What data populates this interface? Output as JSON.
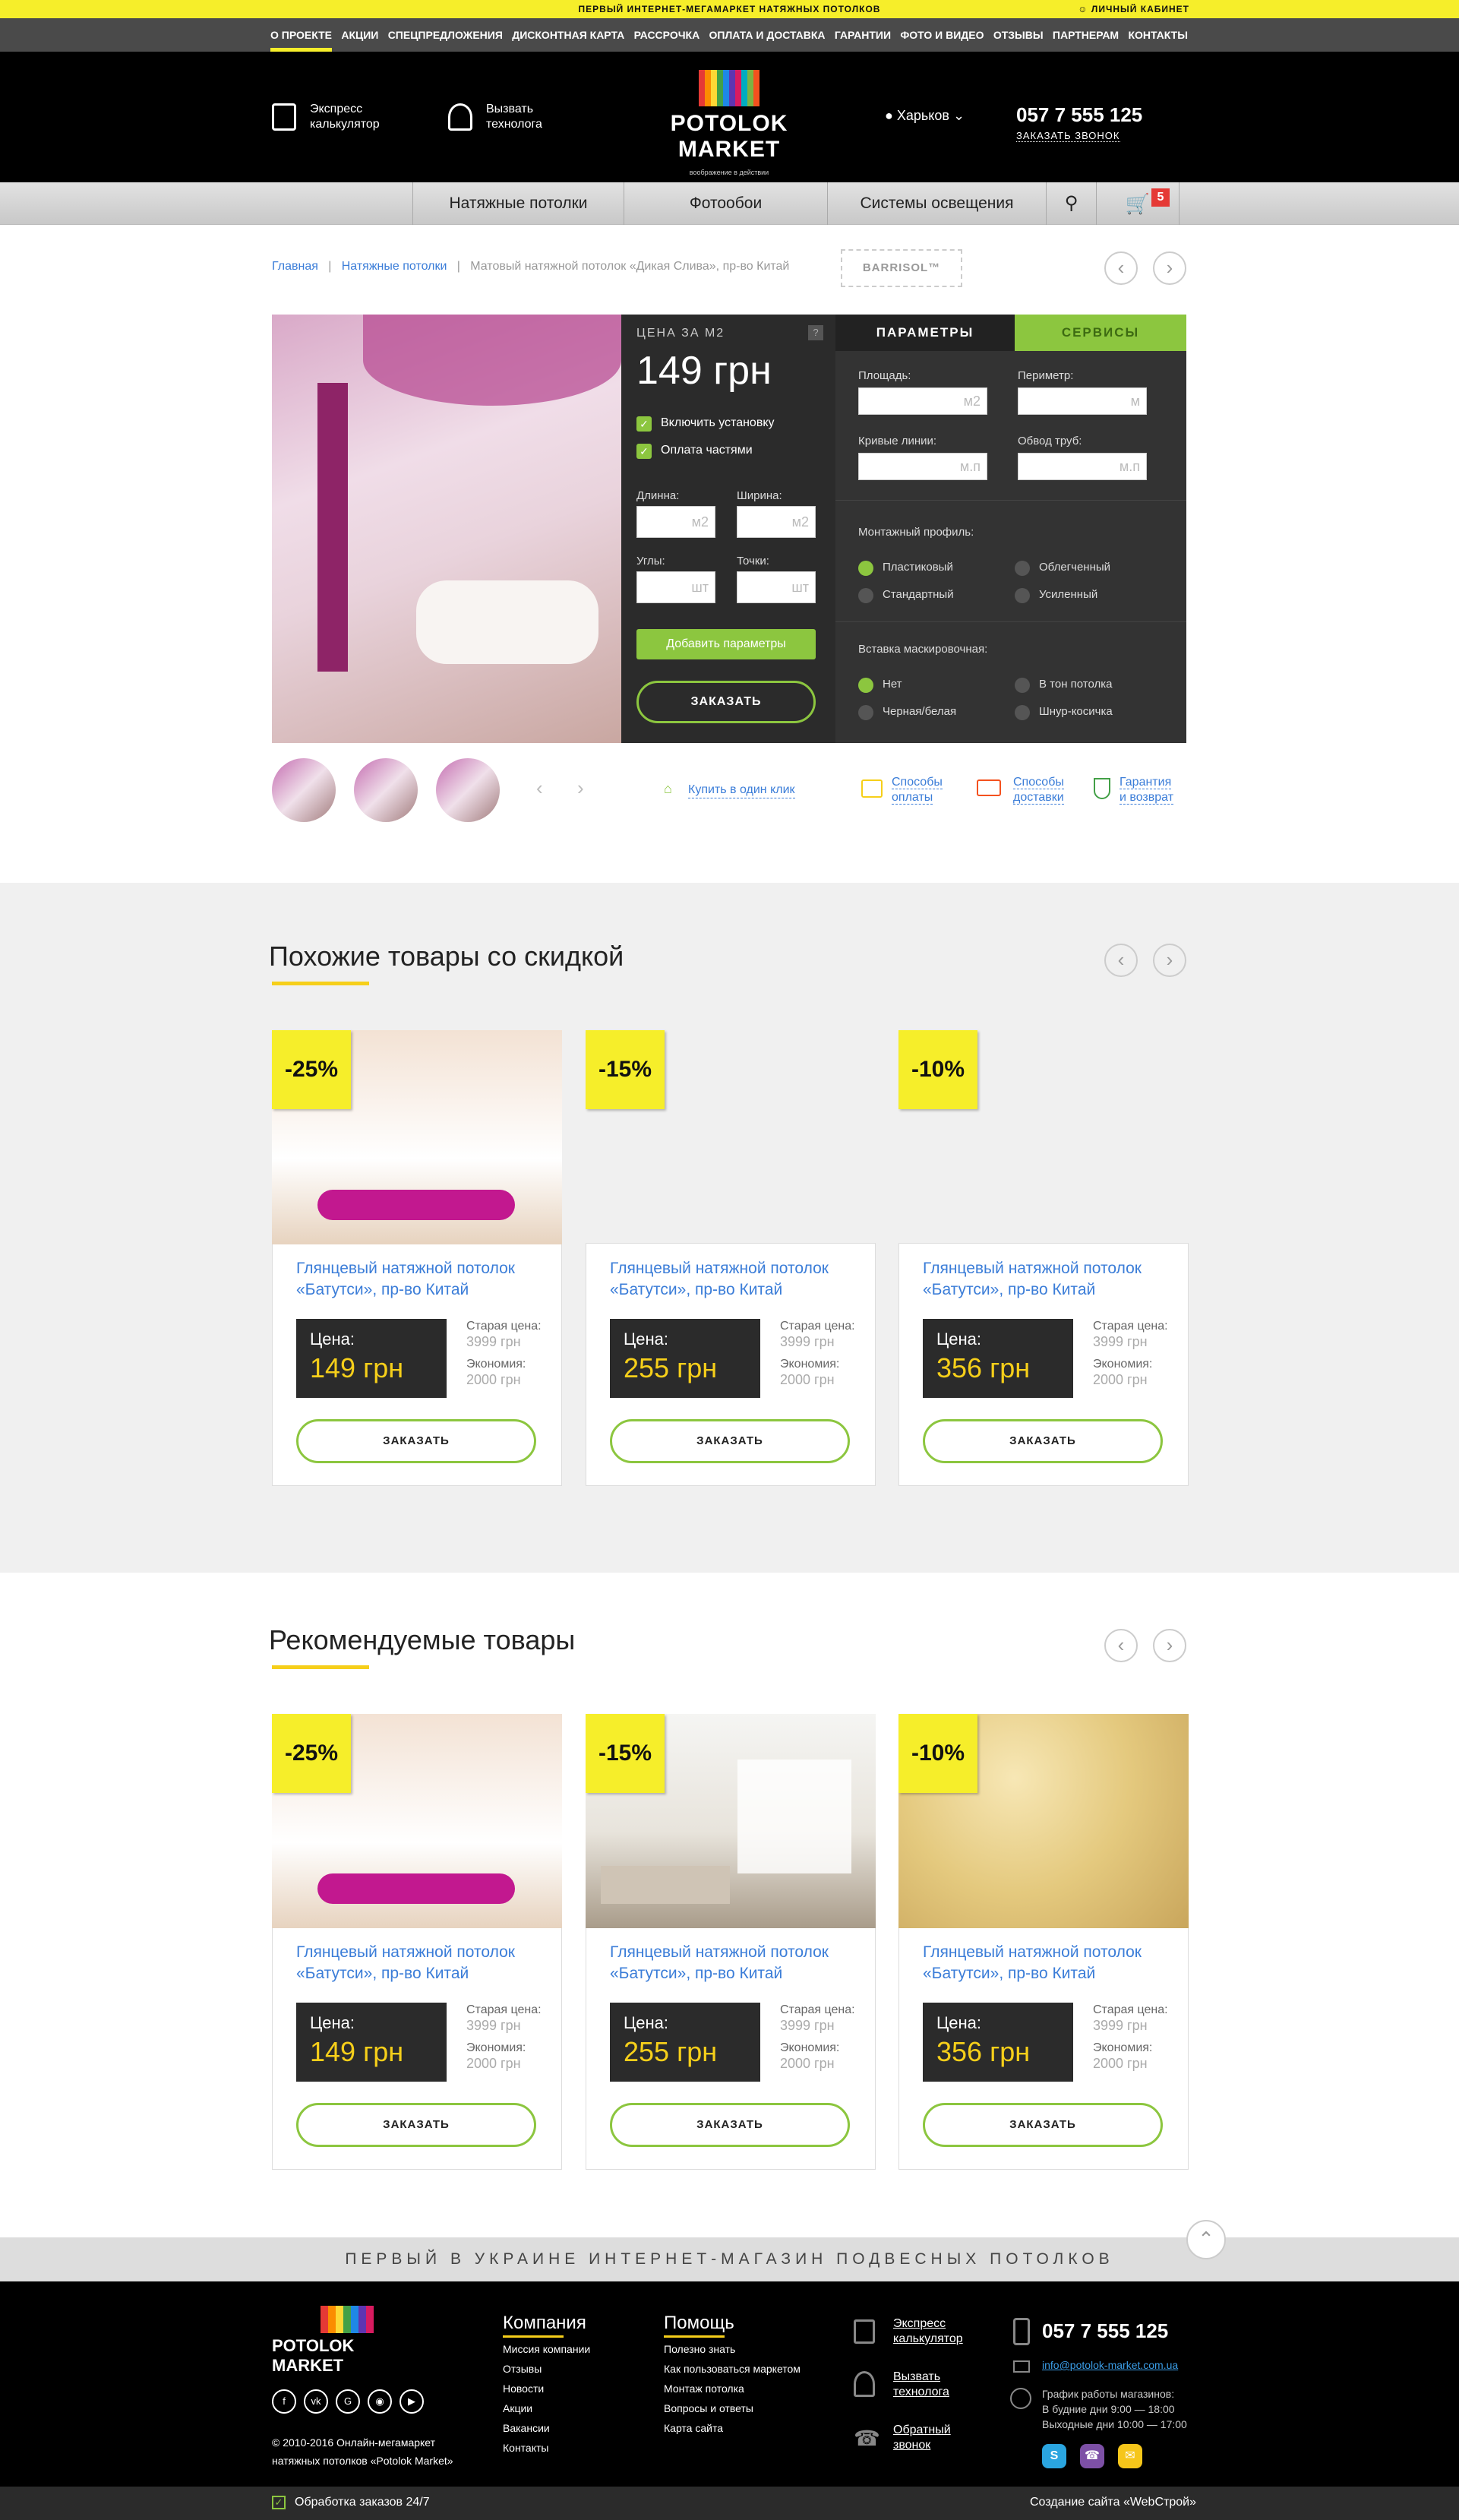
{
  "topbar": {
    "text": "ПЕРВЫЙ ИНТЕРНЕТ-МЕГАМАРКЕТ НАТЯЖНЫХ ПОТОЛКОВ",
    "account": "ЛИЧНЫЙ КАБИНЕТ"
  },
  "nav": [
    "О ПРОЕКТЕ",
    "АКЦИИ",
    "СПЕЦПРЕДЛОЖЕНИЯ",
    "ДИСКОНТНАЯ КАРТА",
    "РАССРОЧКА",
    "ОПЛАТА И ДОСТАВКА",
    "ГАРАНТИИ",
    "ФОТО И ВИДЕО",
    "ОТЗЫВЫ",
    "ПАРТНЕРАМ",
    "КОНТАКТЫ"
  ],
  "header": {
    "calc": "Экспресс калькулятор",
    "tech": "Вызвать технолога",
    "logo": "POTOLOK MARKET",
    "logo_sub": "воображение в действии",
    "city": "Харьков",
    "phone": "057 7 555 125",
    "callback": "ЗАКАЗАТЬ ЗВОНОК"
  },
  "categories": [
    "Натяжные потолки",
    "Фотообои",
    "Системы освещения"
  ],
  "cart_count": "5",
  "breadcrumb": {
    "home": "Главная",
    "cat": "Натяжные потолки",
    "current": "Матовый натяжной потолок «Дикая Слива», пр-во Китай",
    "brand": "BARRISOL™"
  },
  "price": {
    "label": "ЦЕНА ЗА М2",
    "value": "149 грн",
    "opt1": "Включить установку",
    "opt2": "Оплата частями",
    "length": "Длинна:",
    "width": "Ширина:",
    "corners": "Углы:",
    "points": "Точки:",
    "unit_m2": "м2",
    "unit_sht": "шт",
    "add": "Добавить параметры",
    "order": "ЗАКАЗАТЬ"
  },
  "params": {
    "tab1": "ПАРАМЕТРЫ",
    "tab2": "СЕРВИСЫ",
    "area": "Площадь:",
    "perimeter": "Периметр:",
    "curves": "Кривые линии:",
    "pipes": "Обвод труб:",
    "u_m2": "м2",
    "u_m": "м",
    "u_mp": "м.п",
    "profile": "Монтажный профиль:",
    "p1": "Пластиковый",
    "p2": "Облегченный",
    "p3": "Стандартный",
    "p4": "Усиленный",
    "insert": "Вставка маскировочная:",
    "i1": "Нет",
    "i2": "В тон потолка",
    "i3": "Черная/белая",
    "i4": "Шнур-косичка"
  },
  "links": {
    "oneclick": "Купить в один клик",
    "pay1": "Способы",
    "pay2": "оплаты",
    "del1": "Способы",
    "del2": "доставки",
    "gar1": "Гарантия",
    "gar2": "и возврат"
  },
  "similar": {
    "title": "Похожие товары со скидкой"
  },
  "recommended": {
    "title": "Рекомендуемые товары"
  },
  "cards": [
    {
      "discount": "-25%",
      "title": "Глянцевый натяжной потолок «Батутси», пр-во Китай",
      "price": "149 грн"
    },
    {
      "discount": "-15%",
      "title": "Глянцевый натяжной потолок «Батутси», пр-во Китай",
      "price": "255 грн"
    },
    {
      "discount": "-10%",
      "title": "Глянцевый натяжной потолок «Батутси», пр-во Китай",
      "price": "356 грн"
    }
  ],
  "card_common": {
    "price_label": "Цена:",
    "old_label": "Старая цена:",
    "old": "3999 грн",
    "econ_label": "Экономия:",
    "econ": "2000 грн",
    "order": "ЗАКАЗАТЬ"
  },
  "footband": "ПЕРВЫЙ В УКРАИНЕ ИНТЕРНЕТ-МАГАЗИН ПОДВЕСНЫХ ПОТОЛКОВ",
  "footer": {
    "copyright": "© 2010-2016 Онлайн-мегамаркет натяжных потолков «Potolok Market»",
    "company": {
      "title": "Компания",
      "items": [
        "Миссия компании",
        "Отзывы",
        "Новости",
        "Акции",
        "Вакансии",
        "Контакты"
      ]
    },
    "help": {
      "title": "Помощь",
      "items": [
        "Полезно знать",
        "Как пользоваться маркетом",
        "Монтаж потолка",
        "Вопросы и ответы",
        "Карта сайта"
      ]
    },
    "calc": "Экспресс калькулятор",
    "tech": "Вызвать технолога",
    "back": "Обратный звонок",
    "phone": "057 7 555 125",
    "email": "info@potolok-market.com.ua",
    "sched_title": "График работы магазинов:",
    "sched1": "В будние дни 9:00 — 18:00",
    "sched2": "Выходные дни 10:00 — 17:00"
  },
  "bottombar": {
    "left": "Обработка заказов 24/7",
    "right": "Создание сайта «WebСтрой»"
  }
}
